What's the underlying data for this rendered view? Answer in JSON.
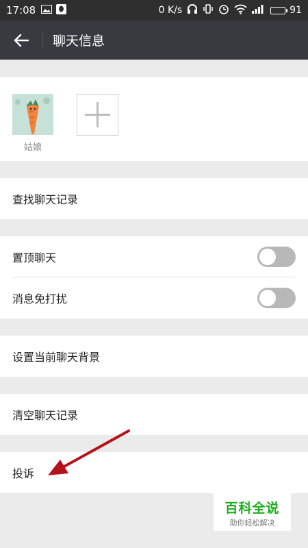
{
  "status_bar": {
    "time": "17:08",
    "net_speed": "0 K/s",
    "battery_level": "91",
    "icons": [
      "image-icon",
      "qq-icon",
      "headset-icon",
      "vibrate-icon",
      "alarm-icon",
      "wifi-icon",
      "signal-icon",
      "battery-icon"
    ]
  },
  "header": {
    "title": "聊天信息",
    "back_icon": "arrow-left-icon"
  },
  "members": [
    {
      "name": "姑娘"
    }
  ],
  "settings": {
    "search_history": "查找聊天记录",
    "pin_chat": {
      "label": "置顶聊天",
      "enabled": false
    },
    "mute": {
      "label": "消息免打扰",
      "enabled": false
    },
    "set_background": "设置当前聊天背景",
    "clear_history": "清空聊天记录",
    "report": "投诉"
  },
  "watermark": {
    "main": "百科全说",
    "sub": "助你轻松解决"
  },
  "colors": {
    "header_bg": "#393a3f",
    "status_bg": "#2f2f2f",
    "page_bg": "#ebebeb",
    "toggle_off": "#b8b8b8",
    "annotation_arrow": "#b5121b",
    "watermark_green": "#1aad19"
  }
}
